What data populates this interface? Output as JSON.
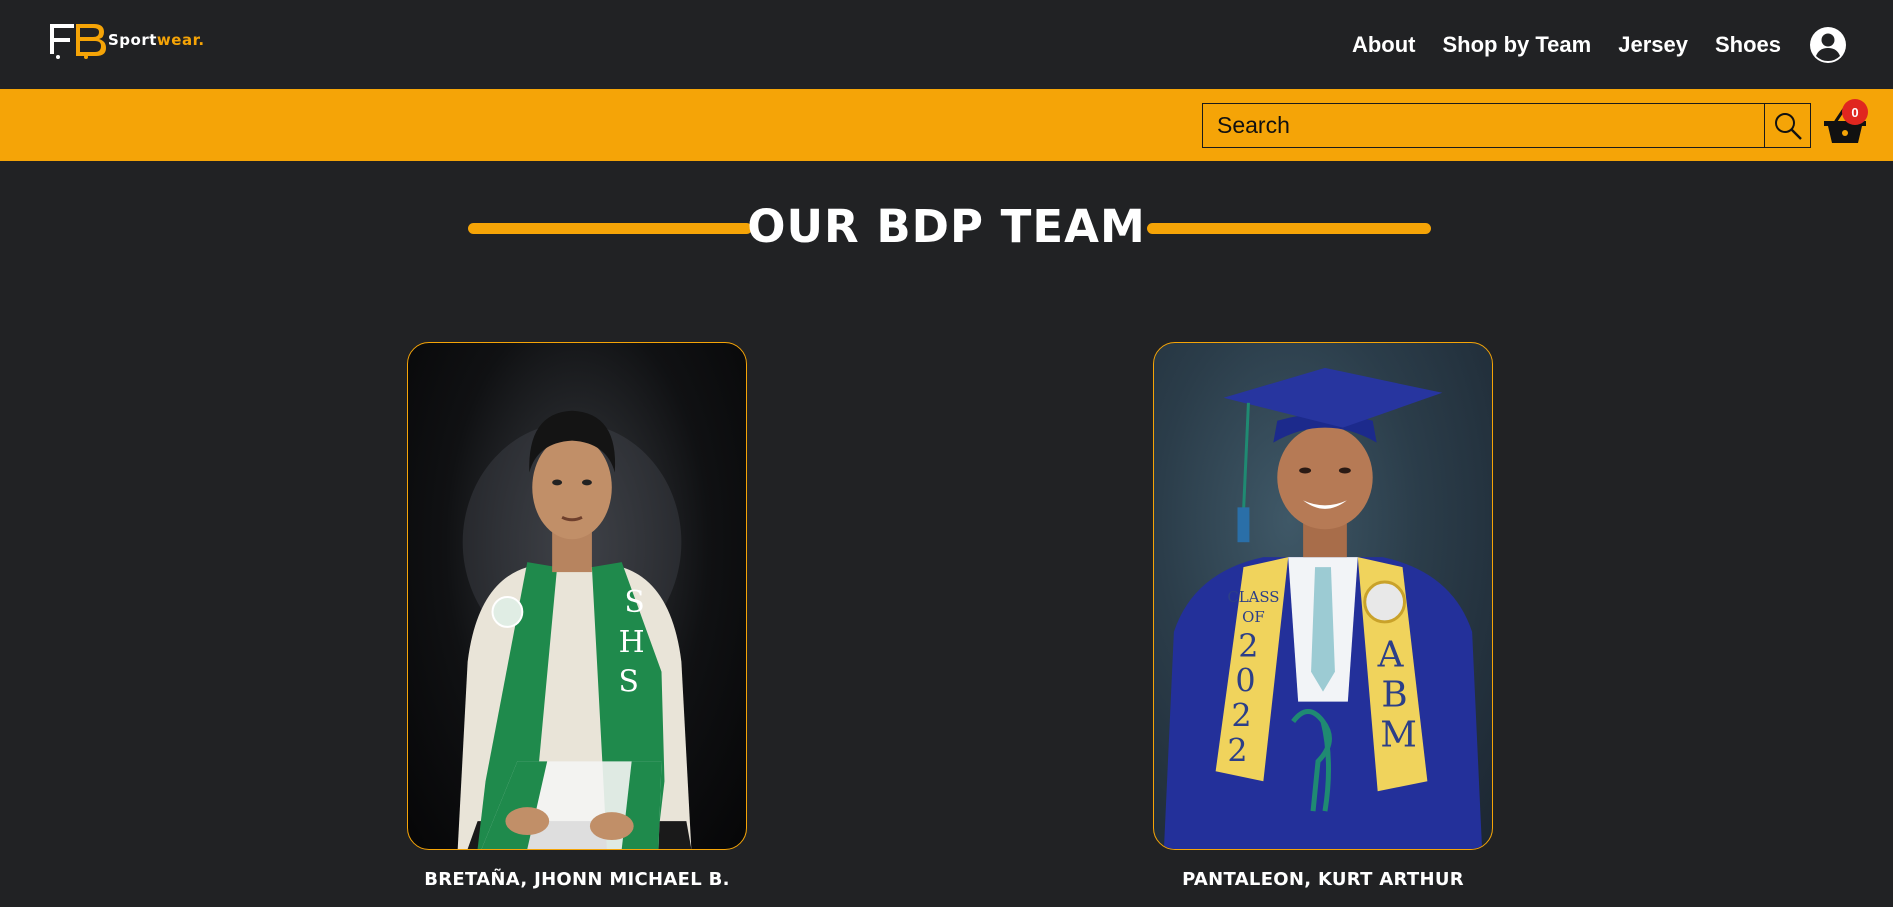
{
  "brand": {
    "logo_mark": "PB",
    "name_part1": "Sport",
    "name_part2": "wear.",
    "accent": "#f5a407"
  },
  "nav": {
    "items": [
      {
        "label": "About"
      },
      {
        "label": "Shop by Team"
      },
      {
        "label": "Jersey"
      },
      {
        "label": "Shoes"
      }
    ],
    "user_icon": "user-circle-icon"
  },
  "search": {
    "placeholder": "Search",
    "icon": "search-icon"
  },
  "cart": {
    "count": "0",
    "icon": "basket-icon",
    "badge_color": "#e0261f"
  },
  "section": {
    "title": "OUR BDP TEAM"
  },
  "team": [
    {
      "name": "BRETAÑA, JHONN MICHAEL B.",
      "sash_text": "SHS"
    },
    {
      "name": "PANTALEON, KURT ARTHUR",
      "sash_text_left": "CLASS OF 2022",
      "sash_text_right": "ABM"
    }
  ],
  "colors": {
    "background": "#212224",
    "accent": "#f5a407"
  }
}
